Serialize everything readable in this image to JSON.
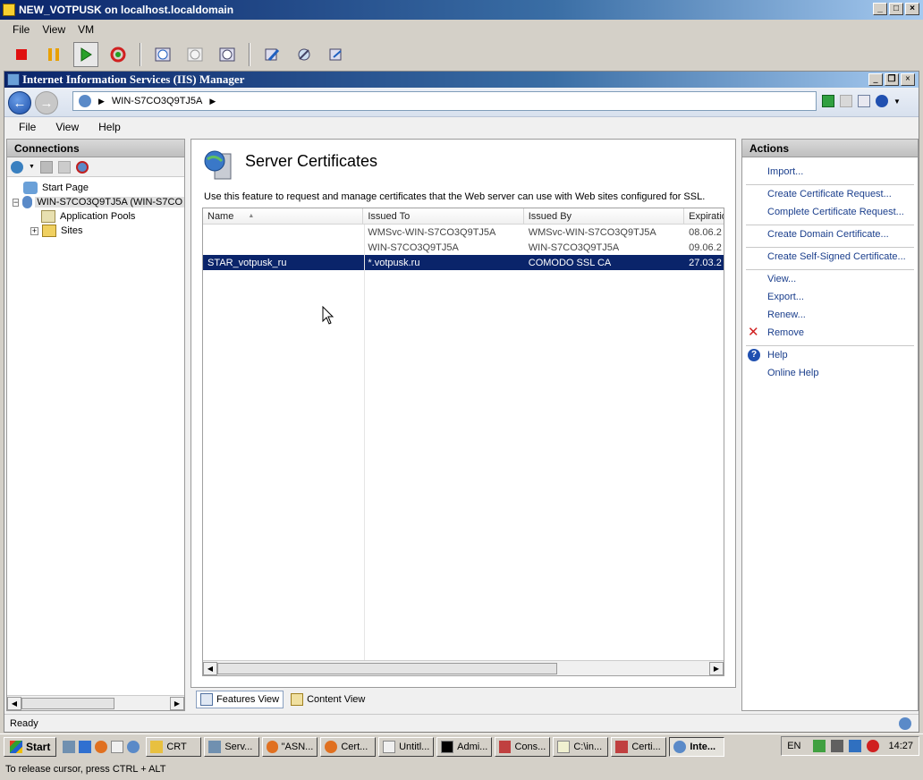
{
  "vm_window": {
    "title": "NEW_VOTPUSK on localhost.localdomain",
    "menu": [
      "File",
      "View",
      "VM"
    ]
  },
  "iis_window": {
    "title": "Internet Information Services (IIS) Manager",
    "address": "WIN-S7CO3Q9TJ5A",
    "menu": [
      "File",
      "View",
      "Help"
    ]
  },
  "connections": {
    "header": "Connections",
    "tree": [
      {
        "label": "Start Page"
      },
      {
        "label": "WIN-S7CO3Q9TJ5A (WIN-S7CO"
      },
      {
        "label": "Application Pools"
      },
      {
        "label": "Sites"
      }
    ]
  },
  "main": {
    "title": "Server Certificates",
    "description": "Use this feature to request and manage certificates that the Web server can use with Web sites configured for SSL.",
    "columns": [
      "Name",
      "Issued To",
      "Issued By",
      "Expiratio"
    ],
    "rows": [
      {
        "name": "",
        "issued_to": "WMSvc-WIN-S7CO3Q9TJ5A",
        "issued_by": "WMSvc-WIN-S7CO3Q9TJ5A",
        "expiration": "08.06.2"
      },
      {
        "name": "",
        "issued_to": "WIN-S7CO3Q9TJ5A",
        "issued_by": "WIN-S7CO3Q9TJ5A",
        "expiration": "09.06.2"
      },
      {
        "name": "STAR_votpusk_ru",
        "issued_to": "*.votpusk.ru",
        "issued_by": "COMODO SSL CA",
        "expiration": "27.03.2"
      }
    ],
    "view_tabs": [
      "Features View",
      "Content View"
    ]
  },
  "actions": {
    "header": "Actions",
    "items": [
      "Import...",
      "Create Certificate Request...",
      "Complete Certificate Request...",
      "Create Domain Certificate...",
      "Create Self-Signed Certificate...",
      "View...",
      "Export...",
      "Renew...",
      "Remove",
      "Help",
      "Online Help"
    ]
  },
  "status": {
    "text": "Ready"
  },
  "taskbar": {
    "start": "Start",
    "tasks": [
      "CRT",
      "Serv...",
      "\"ASN...",
      "Cert...",
      "Untitl...",
      "Admi...",
      "Cons...",
      "C:\\in...",
      "Certi...",
      "Inte..."
    ],
    "language": "EN",
    "clock": "14:27"
  },
  "vm_status": "To release cursor, press CTRL + ALT",
  "colors": {
    "selection": "#0a246a",
    "link": "#1a3e8c",
    "title_bar": "#0a246a"
  }
}
